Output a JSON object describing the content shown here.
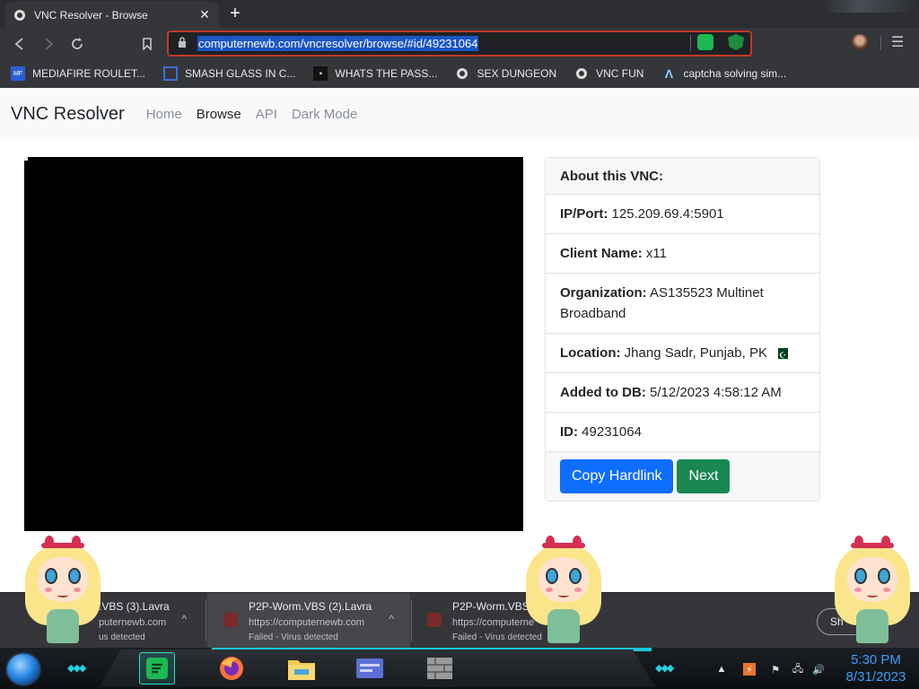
{
  "tab": {
    "title": "VNC Resolver - Browse",
    "close": "✕",
    "new_tab": "+"
  },
  "toolbar": {
    "url": "computernewb.com/vncresolver/browse/#id/49231064"
  },
  "bookmarks": [
    {
      "label": "MEDIAFIRE ROULET...",
      "icon": "mediafire-icon"
    },
    {
      "label": "SMASH GLASS IN C...",
      "icon": "glass-icon"
    },
    {
      "label": "WHATS THE PASS...",
      "icon": "lock-icon"
    },
    {
      "label": "SEX DUNGEON",
      "icon": "vnc-icon"
    },
    {
      "label": "VNC FUN",
      "icon": "vnc-icon"
    },
    {
      "label": "captcha solving sim...",
      "icon": "lambda-icon"
    }
  ],
  "navbar": {
    "brand": "VNC Resolver",
    "links": [
      "Home",
      "Browse",
      "API",
      "Dark Mode"
    ],
    "active": "Browse"
  },
  "card": {
    "header": "About this VNC:",
    "ip_label": "IP/Port:",
    "ip_value": "125.209.69.4:5901",
    "client_label": "Client Name:",
    "client_value": "x11",
    "org_label": "Organization:",
    "org_value": "AS135523 Multinet Broadband",
    "location_label": "Location:",
    "location_value": "Jhang Sadr, Punjab, PK",
    "added_label": "Added to DB:",
    "added_value": "5/12/2023 4:58:12 AM",
    "id_label": "ID:",
    "id_value": "49231064",
    "copy_button": "Copy Hardlink",
    "next_button": "Next"
  },
  "downloads": [
    {
      "name": ".VBS (3).Lavra",
      "source": "puternewb.com",
      "status": "us detected"
    },
    {
      "name": "P2P-Worm.VBS (2).Lavra",
      "source": "https://computernewb.com",
      "status": "Failed - Virus detected"
    },
    {
      "name": "P2P-Worm.VBS (1",
      "source": "https://computerne",
      "status": "Failed - Virus detected"
    }
  ],
  "show_all": "Sh",
  "clock": {
    "time": "5:30 PM",
    "date": "8/31/2023"
  },
  "colors": {
    "accent": "#0d6efd",
    "success": "#198754",
    "url_highlight": "#1a56c4",
    "clock": "#3aa0ff"
  }
}
